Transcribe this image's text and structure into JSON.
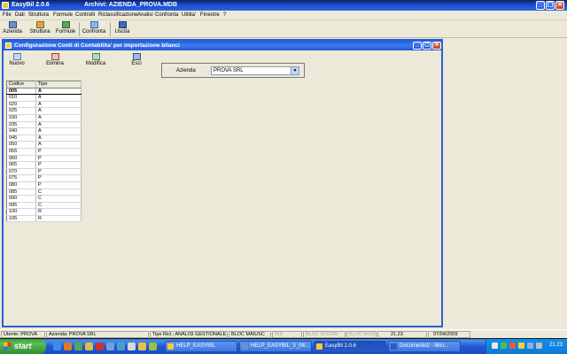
{
  "app": {
    "title": "EasyBil   2.0.6",
    "archive": "Archivi: AZIENDA_PROVA.MDB"
  },
  "menu": [
    "File",
    "Dati",
    "Struttura",
    "Formule",
    "Controlli",
    "Riclassificazione",
    "Analisi",
    "Confronta",
    "Utilita'",
    "Finestre",
    "?"
  ],
  "toolbar": {
    "azienda": "Azienda",
    "struttura": "Struttura",
    "formule": "Formule",
    "confronta": "Confronta",
    "uscita": "Uscita"
  },
  "child": {
    "title": "Configurazione Conti di Contabilita' per importazione bilanci",
    "buttons": {
      "nuovo": "Nuovo",
      "elimina": "Elimina",
      "modifica": "Modifica",
      "esci": "Esci"
    },
    "azienda_label": "Azienda",
    "azienda_value": "PROVA SRL"
  },
  "grid": {
    "headers": [
      "Codice",
      "Tipo"
    ],
    "rows": [
      [
        "005",
        "A"
      ],
      [
        "010",
        "A"
      ],
      [
        "020",
        "A"
      ],
      [
        "025",
        "A"
      ],
      [
        "030",
        "A"
      ],
      [
        "035",
        "A"
      ],
      [
        "040",
        "A"
      ],
      [
        "045",
        "A"
      ],
      [
        "050",
        "A"
      ],
      [
        "055",
        "P"
      ],
      [
        "060",
        "P"
      ],
      [
        "065",
        "P"
      ],
      [
        "070",
        "P"
      ],
      [
        "075",
        "P"
      ],
      [
        "080",
        "P"
      ],
      [
        "085",
        "C"
      ],
      [
        "090",
        "C"
      ],
      [
        "095",
        "C"
      ],
      [
        "100",
        "R"
      ],
      [
        "105",
        "R"
      ]
    ]
  },
  "statusbar": {
    "utente": "Utente: PROVA",
    "azienda": "Azienda: PROVA SRL",
    "tipo_ricl": "Tipo Ricl.: ANALISI GESTIONALE",
    "bloc_maiusc": "BLOC MAIUSC",
    "ins": "INS",
    "bloc_scorr": "BLOC SCORR",
    "bloc_num": "BLOC NUM",
    "time": "21.23",
    "date": "07/04/2009"
  },
  "taskbar": {
    "start": "start",
    "tasks": [
      "HELP_EASYBIL",
      "HELP_EASYBIL_3_(W...",
      "EasyBil   2.0.6",
      "Documento2 - Micr..."
    ],
    "clock": "21.23"
  },
  "colors": {
    "titlebar": "#1a4bc8",
    "window_bg": "#ece9d8",
    "taskbar": "#2157d7",
    "start_green": "#3c9a3c"
  }
}
